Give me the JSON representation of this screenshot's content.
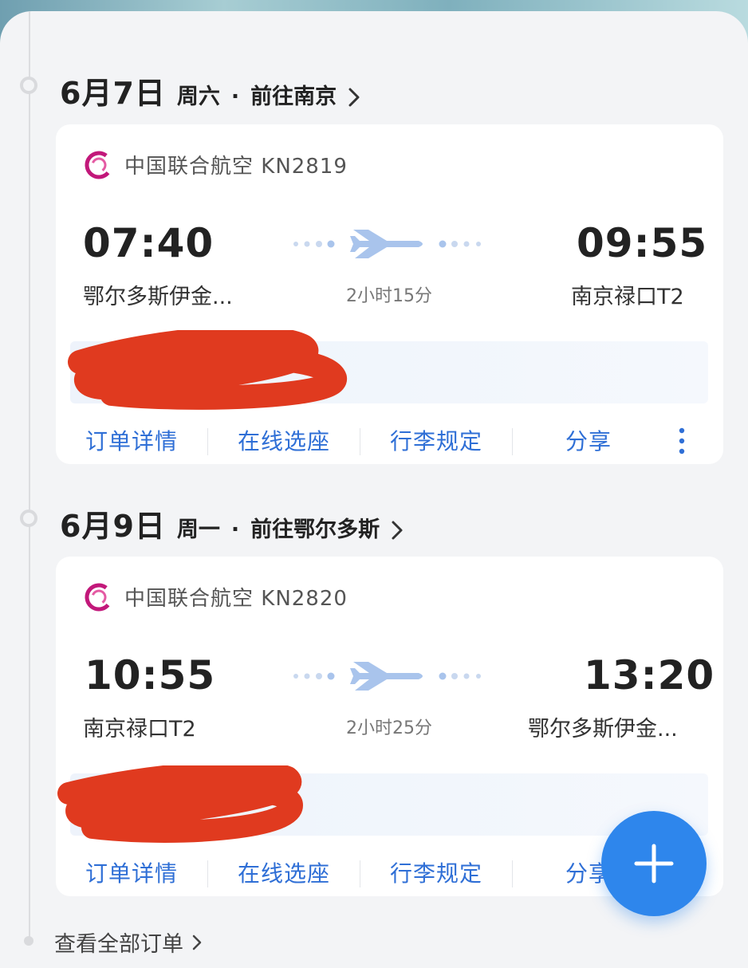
{
  "trips": [
    {
      "date": "6月7日",
      "weekday": "周六",
      "separator": "·",
      "destination": "前往南京",
      "airline": "中国联合航空 KN2819",
      "depart_time": "07:40",
      "depart_airport": "鄂尔多斯伊金...",
      "arrive_time": "09:55",
      "arrive_airport": "南京禄口T2",
      "duration": "2小时15分",
      "actions": [
        "订单详情",
        "在线选座",
        "行李规定",
        "分享"
      ]
    },
    {
      "date": "6月9日",
      "weekday": "周一",
      "separator": "·",
      "destination": "前往鄂尔多斯",
      "airline": "中国联合航空 KN2820",
      "depart_time": "10:55",
      "depart_airport": "南京禄口T2",
      "arrive_time": "13:20",
      "arrive_airport": "鄂尔多斯伊金...",
      "duration": "2小时25分",
      "actions": [
        "订单详情",
        "在线选座",
        "行李规定",
        "分享"
      ]
    }
  ],
  "view_all": "查看全部订单",
  "colors": {
    "accent": "#2f6fd6",
    "fab": "#2e86ec",
    "redaction": "#e03a1f",
    "plane": "#a9c4ec"
  },
  "icons": {
    "fab": "plus-icon",
    "more": "more-vertical-icon",
    "chevron": "chevron-right-icon",
    "plane": "airplane-icon",
    "airline": "airline-logo-icon"
  }
}
